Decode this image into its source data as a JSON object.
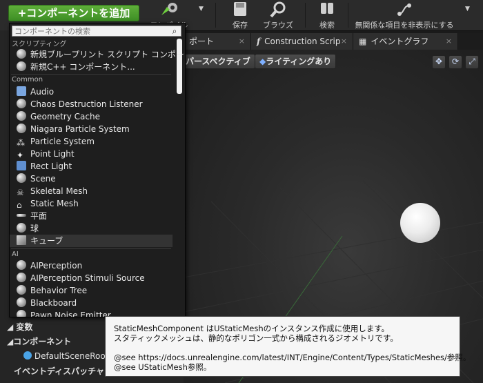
{
  "toolbar": {
    "add_button": "+コンポーネントを追加",
    "compile": "コンパイル",
    "save": "保存",
    "browse": "ブラウズ",
    "search": "検索",
    "hide_unrelated": "無関係な項目を非表示にする"
  },
  "tabs": [
    {
      "label": "ポート",
      "close": "×"
    },
    {
      "label": "Construction Scrip",
      "close": "×"
    },
    {
      "label": "イベントグラフ",
      "close": "×"
    }
  ],
  "viewport": {
    "perspective_label": "パースペクティブ",
    "lighting_label": "ライティングあり"
  },
  "dropdown": {
    "search_placeholder": "コンポーネントの検索",
    "categories": [
      {
        "name": "スクリプティング",
        "items": [
          "新規ブループリント スクリプト コンポー...",
          "新規C++ コンポーネント..."
        ]
      },
      {
        "name": "Common",
        "items": [
          "Audio",
          "Chaos Destruction Listener",
          "Geometry Cache",
          "Niagara Particle System",
          "Particle System",
          "Point Light",
          "Rect Light",
          "Scene",
          "Skeletal Mesh",
          "Static Mesh",
          "平面",
          "球",
          "キューブ"
        ]
      },
      {
        "name": "AI",
        "items": [
          "AIPerception",
          "AIPerception Stimuli Source",
          "Behavior Tree",
          "Blackboard",
          "Pawn Noise Emitter"
        ]
      }
    ],
    "selected_item": "キューブ"
  },
  "left_panel": {
    "variables": "変数",
    "components": "コンポーネント",
    "default_scene_root": "DefaultSceneRoot",
    "event_dispatchers": "イベントディスパッチャ"
  },
  "tooltip": {
    "line1": "StaticMeshComponent はUStaticMeshのインスタンス作成に使用します。",
    "line2": "スタティックメッシュは、静的なポリゴン一式から構成されるジオメトリです。",
    "line3": "@see https://docs.unrealengine.com/latest/INT/Engine/Content/Types/StaticMeshes/参照。",
    "line4": "@see UStaticMesh参照。"
  }
}
